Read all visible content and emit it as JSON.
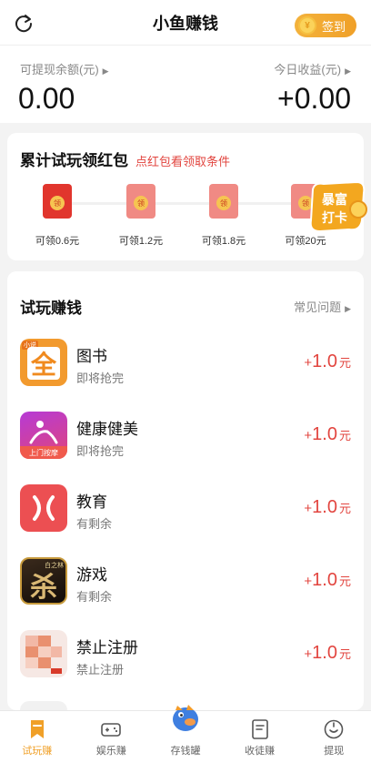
{
  "header": {
    "title": "小鱼赚钱",
    "signin_label": "签到"
  },
  "balance": {
    "withdrawable_label": "可提现余额(元)",
    "withdrawable_value": "0.00",
    "today_label": "今日收益(元)",
    "today_value": "+0.00"
  },
  "red_packets": {
    "title": "累计试玩领红包",
    "subtitle": "点红包看领取条件",
    "seal_text": "领",
    "items": [
      {
        "label": "可领0.6元"
      },
      {
        "label": "可领1.2元"
      },
      {
        "label": "可领1.8元"
      },
      {
        "label": "可领20元"
      }
    ],
    "badge_text_1": "暴富",
    "badge_text_2": "打卡"
  },
  "tasks": {
    "title": "试玩赚钱",
    "faq_label": "常见问题",
    "amount_unit": "元",
    "items": [
      {
        "name": "图书",
        "status": "即将抢完",
        "amount": "1.0",
        "icon_text": "全",
        "icon_tag": "小说"
      },
      {
        "name": "健康健美",
        "status": "即将抢完",
        "amount": "1.0",
        "icon_text": "上门按摩"
      },
      {
        "name": "教育",
        "status": "有剩余",
        "amount": "1.0"
      },
      {
        "name": "游戏",
        "status": "有剩余",
        "amount": "1.0",
        "icon_text": "杀",
        "icon_tag": "白之林"
      },
      {
        "name": "禁止注册",
        "status": "禁止注册",
        "amount": "1.0"
      }
    ]
  },
  "tabbar": {
    "items": [
      {
        "label": "试玩赚",
        "active": true
      },
      {
        "label": "娱乐赚"
      },
      {
        "label": "存钱罐"
      },
      {
        "label": "收徒赚"
      },
      {
        "label": "提现"
      }
    ]
  },
  "colors": {
    "accent": "#f0a028",
    "red": "#e2453f"
  }
}
